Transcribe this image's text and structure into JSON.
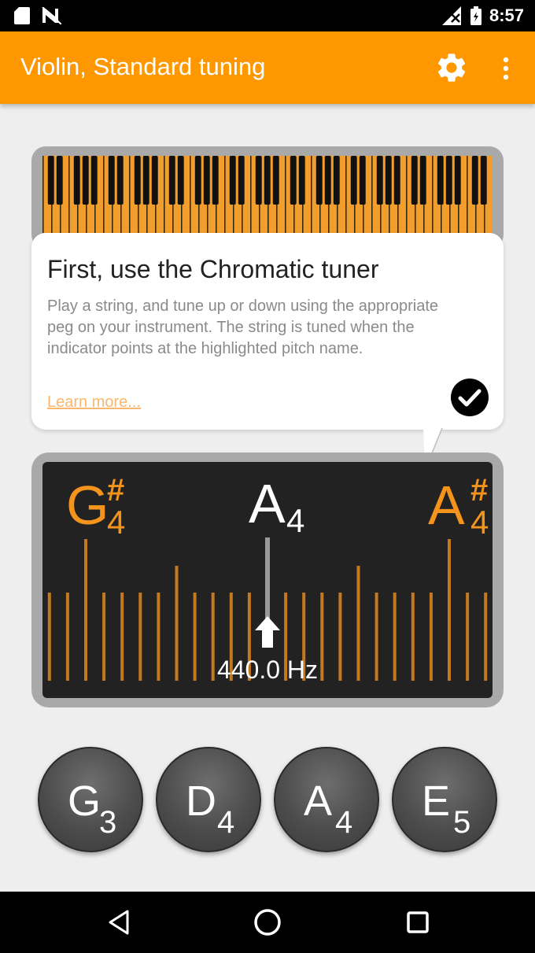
{
  "status_bar": {
    "time": "8:57",
    "icons": [
      "sd-card-icon",
      "no-sim-icon",
      "signal-icon",
      "battery-icon"
    ]
  },
  "app_bar": {
    "title": "Violin, Standard tuning",
    "icons": [
      "gear-icon",
      "more-vert-icon"
    ]
  },
  "tip": {
    "title": "First, use the Chromatic tuner",
    "body": "Play a string, and tune up or down using the appropriate peg on your instrument. The string is tuned when the indicator points at the highlighted pitch name.",
    "link": "Learn more..."
  },
  "tuner": {
    "left_note": {
      "base": "G",
      "accidental": "#",
      "octave": "4"
    },
    "center_note": {
      "base": "A",
      "octave": "4"
    },
    "right_note": {
      "base": "A",
      "accidental": "#",
      "octave": "4"
    },
    "frequency": "440.0 Hz"
  },
  "strings": [
    {
      "base": "G",
      "octave": "3"
    },
    {
      "base": "D",
      "octave": "4"
    },
    {
      "base": "A",
      "octave": "4"
    },
    {
      "base": "E",
      "octave": "5"
    }
  ],
  "colors": {
    "accent": "#ff9800",
    "note_orange": "#f5941d",
    "tick_orange": "#c5791f",
    "piano_orange": "#f29e2c"
  }
}
